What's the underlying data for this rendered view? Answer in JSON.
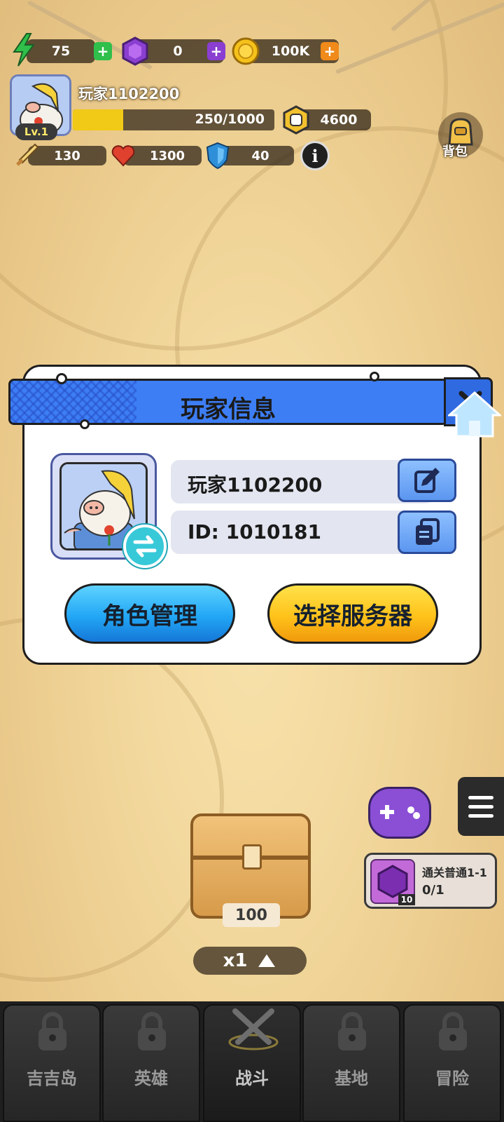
{
  "resources": {
    "energy": "75",
    "gems": "0",
    "coins": "100K"
  },
  "player": {
    "name": "玩家1102200",
    "level": "Lv.1",
    "xp": "250/1000",
    "xp_fraction": 0.25,
    "power": "4600",
    "attack": "130",
    "hp": "1300",
    "defense": "40"
  },
  "bag_label": "背包",
  "modal": {
    "title": "玩家信息",
    "name_value": "玩家1102200",
    "id_value": "ID: 1010181",
    "manage_button": "角色管理",
    "server_button": "选择服务器"
  },
  "quest": {
    "title": "通关普通1-1",
    "progress": "0/1",
    "reward_count": "10"
  },
  "chest_count": "100",
  "speed": "x1",
  "nav": [
    {
      "label": "吉吉岛",
      "locked": true
    },
    {
      "label": "英雄",
      "locked": true
    },
    {
      "label": "战斗",
      "locked": false,
      "active": true
    },
    {
      "label": "基地",
      "locked": true
    },
    {
      "label": "冒险",
      "locked": true
    }
  ],
  "colors": {
    "header_blue": "#3d7ef5",
    "button_blue": "#22a7f5",
    "button_yellow": "#ffc21a",
    "energy_green": "#2fbf4a",
    "gem_purple": "#8a3fd1",
    "coin_gold": "#f4c21a"
  },
  "icons": {
    "energy": "lightning-icon",
    "gem": "gem-icon",
    "coin": "coin-icon",
    "power": "fist-icon",
    "attack": "sword-icon",
    "hp": "heart-icon",
    "defense": "shield-icon",
    "info": "info-icon",
    "edit": "edit-icon",
    "copy": "copy-icon",
    "swap": "swap-icon",
    "close": "close-icon",
    "home": "home-icon",
    "menu": "menu-icon"
  }
}
